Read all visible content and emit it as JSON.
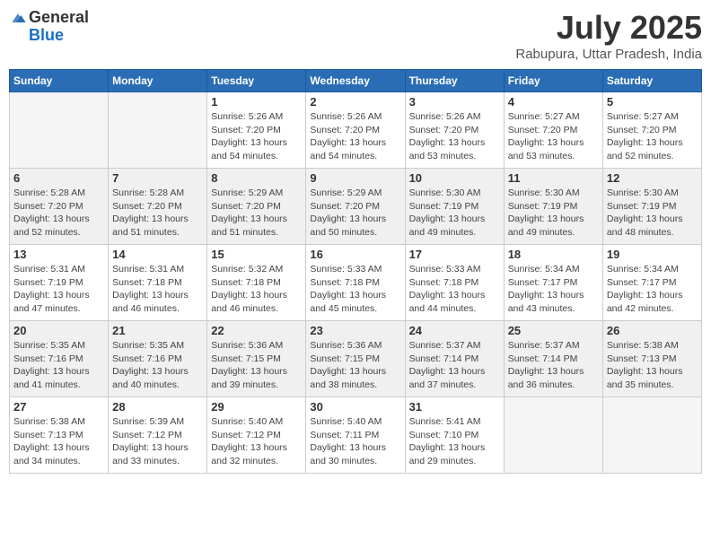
{
  "header": {
    "logo": {
      "line1": "General",
      "line2": "Blue"
    },
    "title": "July 2025",
    "location": "Rabupura, Uttar Pradesh, India"
  },
  "calendar": {
    "days_of_week": [
      "Sunday",
      "Monday",
      "Tuesday",
      "Wednesday",
      "Thursday",
      "Friday",
      "Saturday"
    ],
    "weeks": [
      [
        {
          "day": "",
          "info": ""
        },
        {
          "day": "",
          "info": ""
        },
        {
          "day": "1",
          "info": "Sunrise: 5:26 AM\nSunset: 7:20 PM\nDaylight: 13 hours\nand 54 minutes."
        },
        {
          "day": "2",
          "info": "Sunrise: 5:26 AM\nSunset: 7:20 PM\nDaylight: 13 hours\nand 54 minutes."
        },
        {
          "day": "3",
          "info": "Sunrise: 5:26 AM\nSunset: 7:20 PM\nDaylight: 13 hours\nand 53 minutes."
        },
        {
          "day": "4",
          "info": "Sunrise: 5:27 AM\nSunset: 7:20 PM\nDaylight: 13 hours\nand 53 minutes."
        },
        {
          "day": "5",
          "info": "Sunrise: 5:27 AM\nSunset: 7:20 PM\nDaylight: 13 hours\nand 52 minutes."
        }
      ],
      [
        {
          "day": "6",
          "info": "Sunrise: 5:28 AM\nSunset: 7:20 PM\nDaylight: 13 hours\nand 52 minutes."
        },
        {
          "day": "7",
          "info": "Sunrise: 5:28 AM\nSunset: 7:20 PM\nDaylight: 13 hours\nand 51 minutes."
        },
        {
          "day": "8",
          "info": "Sunrise: 5:29 AM\nSunset: 7:20 PM\nDaylight: 13 hours\nand 51 minutes."
        },
        {
          "day": "9",
          "info": "Sunrise: 5:29 AM\nSunset: 7:20 PM\nDaylight: 13 hours\nand 50 minutes."
        },
        {
          "day": "10",
          "info": "Sunrise: 5:30 AM\nSunset: 7:19 PM\nDaylight: 13 hours\nand 49 minutes."
        },
        {
          "day": "11",
          "info": "Sunrise: 5:30 AM\nSunset: 7:19 PM\nDaylight: 13 hours\nand 49 minutes."
        },
        {
          "day": "12",
          "info": "Sunrise: 5:30 AM\nSunset: 7:19 PM\nDaylight: 13 hours\nand 48 minutes."
        }
      ],
      [
        {
          "day": "13",
          "info": "Sunrise: 5:31 AM\nSunset: 7:19 PM\nDaylight: 13 hours\nand 47 minutes."
        },
        {
          "day": "14",
          "info": "Sunrise: 5:31 AM\nSunset: 7:18 PM\nDaylight: 13 hours\nand 46 minutes."
        },
        {
          "day": "15",
          "info": "Sunrise: 5:32 AM\nSunset: 7:18 PM\nDaylight: 13 hours\nand 46 minutes."
        },
        {
          "day": "16",
          "info": "Sunrise: 5:33 AM\nSunset: 7:18 PM\nDaylight: 13 hours\nand 45 minutes."
        },
        {
          "day": "17",
          "info": "Sunrise: 5:33 AM\nSunset: 7:18 PM\nDaylight: 13 hours\nand 44 minutes."
        },
        {
          "day": "18",
          "info": "Sunrise: 5:34 AM\nSunset: 7:17 PM\nDaylight: 13 hours\nand 43 minutes."
        },
        {
          "day": "19",
          "info": "Sunrise: 5:34 AM\nSunset: 7:17 PM\nDaylight: 13 hours\nand 42 minutes."
        }
      ],
      [
        {
          "day": "20",
          "info": "Sunrise: 5:35 AM\nSunset: 7:16 PM\nDaylight: 13 hours\nand 41 minutes."
        },
        {
          "day": "21",
          "info": "Sunrise: 5:35 AM\nSunset: 7:16 PM\nDaylight: 13 hours\nand 40 minutes."
        },
        {
          "day": "22",
          "info": "Sunrise: 5:36 AM\nSunset: 7:15 PM\nDaylight: 13 hours\nand 39 minutes."
        },
        {
          "day": "23",
          "info": "Sunrise: 5:36 AM\nSunset: 7:15 PM\nDaylight: 13 hours\nand 38 minutes."
        },
        {
          "day": "24",
          "info": "Sunrise: 5:37 AM\nSunset: 7:14 PM\nDaylight: 13 hours\nand 37 minutes."
        },
        {
          "day": "25",
          "info": "Sunrise: 5:37 AM\nSunset: 7:14 PM\nDaylight: 13 hours\nand 36 minutes."
        },
        {
          "day": "26",
          "info": "Sunrise: 5:38 AM\nSunset: 7:13 PM\nDaylight: 13 hours\nand 35 minutes."
        }
      ],
      [
        {
          "day": "27",
          "info": "Sunrise: 5:38 AM\nSunset: 7:13 PM\nDaylight: 13 hours\nand 34 minutes."
        },
        {
          "day": "28",
          "info": "Sunrise: 5:39 AM\nSunset: 7:12 PM\nDaylight: 13 hours\nand 33 minutes."
        },
        {
          "day": "29",
          "info": "Sunrise: 5:40 AM\nSunset: 7:12 PM\nDaylight: 13 hours\nand 32 minutes."
        },
        {
          "day": "30",
          "info": "Sunrise: 5:40 AM\nSunset: 7:11 PM\nDaylight: 13 hours\nand 30 minutes."
        },
        {
          "day": "31",
          "info": "Sunrise: 5:41 AM\nSunset: 7:10 PM\nDaylight: 13 hours\nand 29 minutes."
        },
        {
          "day": "",
          "info": ""
        },
        {
          "day": "",
          "info": ""
        }
      ]
    ]
  }
}
